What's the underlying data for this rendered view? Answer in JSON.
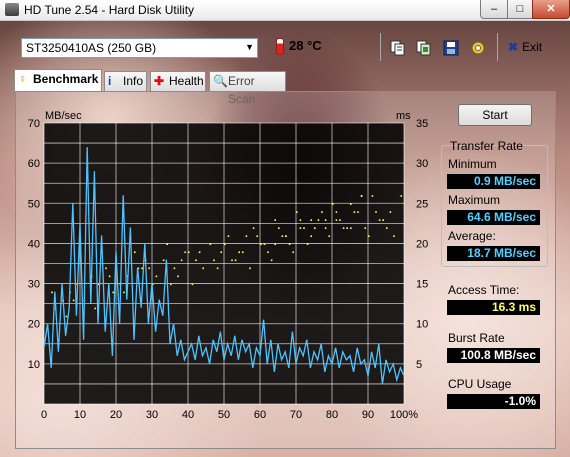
{
  "window": {
    "title": "HD Tune 2.54 - Hard Disk Utility",
    "min_label": "–",
    "max_label": "□",
    "close_label": "✕"
  },
  "toolbar": {
    "drive": "ST3250410AS (250 GB)",
    "temperature": "28 °C",
    "icons": [
      "copy-text-icon",
      "copy-screenshot-icon",
      "save-icon",
      "options-icon"
    ],
    "exit_label": "Exit"
  },
  "tabs": [
    {
      "label": "Benchmark",
      "icon": "benchmark-icon",
      "active": true
    },
    {
      "label": "Info",
      "icon": "info-icon"
    },
    {
      "label": "Health",
      "icon": "health-icon"
    },
    {
      "label": "Error Scan",
      "icon": "error-scan-icon"
    }
  ],
  "side": {
    "start_label": "Start",
    "transfer_rate_label": "Transfer Rate",
    "minimum_label": "Minimum",
    "minimum_value": "0.9 MB/sec",
    "maximum_label": "Maximum",
    "maximum_value": "64.6 MB/sec",
    "average_label": "Average:",
    "average_value": "18.7 MB/sec",
    "access_label": "Access Time:",
    "access_value": "16.3 ms",
    "burst_label": "Burst Rate",
    "burst_value": "100.8 MB/sec",
    "cpu_label": "CPU Usage",
    "cpu_value": "-1.0%"
  },
  "colors": {
    "transfer": "#4fc3ff",
    "access": "#ffff66",
    "chart_bg": "#000000",
    "grid": "#ffffff"
  },
  "chart_data": {
    "type": "line",
    "ylabel": "MB/sec",
    "y2label": "ms",
    "xlim": [
      0,
      100
    ],
    "ylim": [
      0,
      70
    ],
    "y2lim": [
      0,
      35
    ],
    "x_ticks": [
      "0",
      "10",
      "20",
      "30",
      "40",
      "50",
      "60",
      "70",
      "80",
      "90",
      "100%"
    ],
    "y_ticks": [
      "70",
      "60",
      "50",
      "40",
      "30",
      "20",
      "10"
    ],
    "y2_ticks": [
      "35",
      "30",
      "25",
      "20",
      "15",
      "10",
      "5"
    ],
    "series": [
      {
        "name": "Transfer Rate",
        "axis": "left",
        "x": [
          0,
          1,
          2,
          3,
          4,
          5,
          6,
          7,
          8,
          9,
          10,
          11,
          12,
          13,
          14,
          15,
          16,
          17,
          18,
          19,
          20,
          21,
          22,
          23,
          24,
          25,
          26,
          27,
          28,
          29,
          30,
          31,
          32,
          33,
          34,
          35,
          36,
          37,
          38,
          39,
          40,
          41,
          42,
          43,
          44,
          45,
          46,
          47,
          48,
          49,
          50,
          51,
          52,
          53,
          54,
          55,
          56,
          57,
          58,
          59,
          60,
          61,
          62,
          63,
          64,
          65,
          66,
          67,
          68,
          69,
          70,
          71,
          72,
          73,
          74,
          75,
          76,
          77,
          78,
          79,
          80,
          81,
          82,
          83,
          84,
          85,
          86,
          87,
          88,
          89,
          90,
          91,
          92,
          93,
          94,
          95,
          96,
          97,
          98,
          99,
          100
        ],
        "values": [
          14,
          20,
          9,
          28,
          13,
          30,
          17,
          24,
          50,
          22,
          45,
          16,
          64,
          25,
          58,
          20,
          42,
          18,
          30,
          12,
          38,
          20,
          52,
          26,
          44,
          16,
          34,
          24,
          40,
          20,
          30,
          18,
          26,
          22,
          36,
          15,
          20,
          12,
          16,
          11,
          13,
          15,
          11,
          17,
          12,
          14,
          10,
          16,
          13,
          18,
          11,
          15,
          12,
          17,
          11,
          16,
          13,
          15,
          9,
          14,
          12,
          21,
          10,
          16,
          8,
          15,
          11,
          13,
          9,
          18,
          10,
          14,
          12,
          16,
          9,
          13,
          11,
          15,
          8,
          12,
          10,
          14,
          9,
          13,
          11,
          12,
          8,
          14,
          10,
          11,
          7,
          13,
          9,
          15,
          5,
          11,
          8,
          10,
          6,
          9,
          7
        ]
      },
      {
        "name": "Access Time",
        "axis": "right",
        "x": [
          2,
          5,
          9,
          13,
          17,
          21,
          25,
          28,
          31,
          34,
          36,
          38,
          41,
          43,
          46,
          48,
          51,
          53,
          55,
          58,
          60,
          62,
          64,
          66,
          68,
          70,
          72,
          74,
          76,
          78,
          80,
          82,
          84,
          86,
          88,
          90,
          93,
          96,
          3,
          7,
          11,
          15,
          19,
          23,
          27,
          30,
          33,
          37,
          40,
          44,
          47,
          50,
          54,
          57,
          59,
          61,
          63,
          65,
          67,
          69,
          71,
          73,
          75,
          77,
          79,
          81,
          83,
          85,
          87,
          89,
          91,
          94,
          97,
          6,
          14,
          22,
          29,
          35,
          42,
          49,
          56,
          64,
          71,
          78,
          85,
          92,
          99,
          8,
          18,
          26,
          39,
          52,
          60,
          67,
          74,
          81,
          88,
          95
        ],
        "values": [
          14,
          13,
          15,
          16,
          17,
          15,
          19,
          18,
          16,
          20,
          17,
          18,
          15,
          19,
          20,
          17,
          21,
          18,
          19,
          22,
          20,
          19,
          23,
          21,
          20,
          24,
          22,
          21,
          23,
          22,
          25,
          23,
          22,
          24,
          26,
          21,
          23,
          24,
          12,
          14,
          13,
          15,
          14,
          16,
          17,
          15,
          18,
          16,
          19,
          17,
          18,
          20,
          19,
          17,
          21,
          20,
          18,
          22,
          21,
          19,
          23,
          20,
          22,
          24,
          21,
          23,
          22,
          25,
          24,
          22,
          26,
          23,
          21,
          11,
          12,
          14,
          17,
          15,
          18,
          19,
          21,
          20,
          22,
          23,
          22,
          24,
          26,
          13,
          16,
          17,
          19,
          18,
          20,
          21,
          23,
          24,
          26,
          22
        ]
      }
    ]
  }
}
